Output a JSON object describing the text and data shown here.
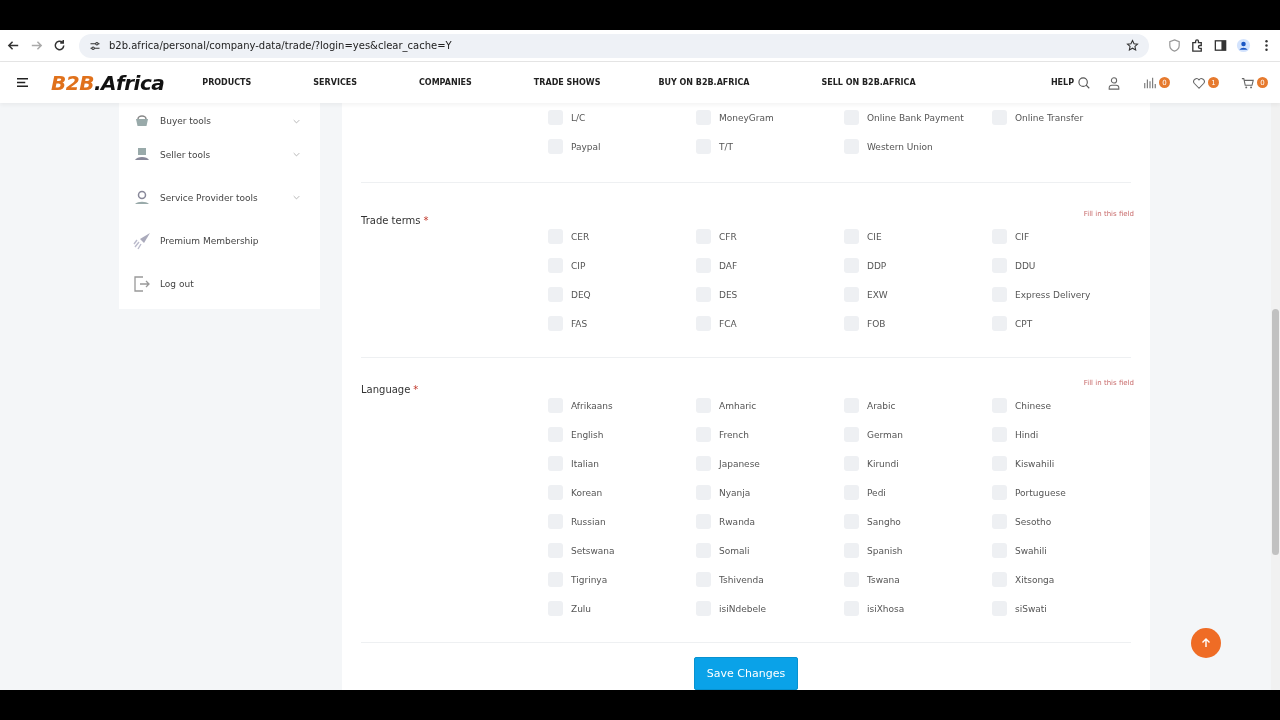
{
  "browser": {
    "url": "b2b.africa/personal/company-data/trade/?login=yes&clear_cache=Y"
  },
  "header": {
    "logo": {
      "brand": "B2B",
      "suffix": ".Africa"
    },
    "nav": [
      "PRODUCTS",
      "SERVICES",
      "COMPANIES",
      "TRADE SHOWS",
      "BUY ON B2B.AFRICA",
      "SELL ON B2B.AFRICA"
    ],
    "help": "HELP",
    "compare_count": "0",
    "wishlist_count": "1",
    "cart_count": "0"
  },
  "sidebar": {
    "items": [
      {
        "label": "Buyer tools",
        "expandable": true
      },
      {
        "label": "Seller tools",
        "expandable": true
      },
      {
        "label": "Service Provider tools",
        "expandable": true
      },
      {
        "label": "Premium Membership",
        "expandable": false
      },
      {
        "label": "Log out",
        "expandable": false
      }
    ]
  },
  "sections": [
    {
      "options": [
        {
          "label": "L/C",
          "checked": false
        },
        {
          "label": "MoneyGram",
          "checked": false
        },
        {
          "label": "Online Bank Payment",
          "checked": false
        },
        {
          "label": "Online Transfer",
          "checked": false
        },
        {
          "label": "Paypal",
          "checked": false
        },
        {
          "label": "T/T",
          "checked": false
        },
        {
          "label": "Western Union",
          "checked": false
        }
      ]
    },
    {
      "label": "Trade terms",
      "required_mark": "*",
      "error": "Fill in this field",
      "options": [
        {
          "label": "CER",
          "checked": false
        },
        {
          "label": "CFR",
          "checked": false
        },
        {
          "label": "CIE",
          "checked": false
        },
        {
          "label": "CIF",
          "checked": false
        },
        {
          "label": "CIP",
          "checked": false
        },
        {
          "label": "DAF",
          "checked": false
        },
        {
          "label": "DDP",
          "checked": false
        },
        {
          "label": "DDU",
          "checked": false
        },
        {
          "label": "DEQ",
          "checked": false
        },
        {
          "label": "DES",
          "checked": false
        },
        {
          "label": "EXW",
          "checked": false
        },
        {
          "label": "Express Delivery",
          "checked": false
        },
        {
          "label": "FAS",
          "checked": false
        },
        {
          "label": "FCA",
          "checked": false
        },
        {
          "label": "FOB",
          "checked": false
        },
        {
          "label": "CPT",
          "checked": false
        }
      ]
    },
    {
      "label": "Language",
      "required_mark": "*",
      "error": "Fill in this field",
      "options": [
        {
          "label": "Afrikaans",
          "checked": false
        },
        {
          "label": "Amharic",
          "checked": false
        },
        {
          "label": "Arabic",
          "checked": false
        },
        {
          "label": "Chinese",
          "checked": false
        },
        {
          "label": "English",
          "checked": false
        },
        {
          "label": "French",
          "checked": false
        },
        {
          "label": "German",
          "checked": false
        },
        {
          "label": "Hindi",
          "checked": false
        },
        {
          "label": "Italian",
          "checked": false
        },
        {
          "label": "Japanese",
          "checked": false
        },
        {
          "label": "Kirundi",
          "checked": false
        },
        {
          "label": "Kiswahili",
          "checked": false
        },
        {
          "label": "Korean",
          "checked": false
        },
        {
          "label": "Nyanja",
          "checked": false
        },
        {
          "label": "Pedi",
          "checked": false
        },
        {
          "label": "Portuguese",
          "checked": false
        },
        {
          "label": "Russian",
          "checked": false
        },
        {
          "label": "Rwanda",
          "checked": false
        },
        {
          "label": "Sangho",
          "checked": false
        },
        {
          "label": "Sesotho",
          "checked": false
        },
        {
          "label": "Setswana",
          "checked": false
        },
        {
          "label": "Somali",
          "checked": false
        },
        {
          "label": "Spanish",
          "checked": false
        },
        {
          "label": "Swahili",
          "checked": false
        },
        {
          "label": "Tigrinya",
          "checked": false
        },
        {
          "label": "Tshivenda",
          "checked": false
        },
        {
          "label": "Tswana",
          "checked": false
        },
        {
          "label": "Xitsonga",
          "checked": false
        },
        {
          "label": "Zulu",
          "checked": false
        },
        {
          "label": "isiNdebele",
          "checked": false
        },
        {
          "label": "isiXhosa",
          "checked": false
        },
        {
          "label": "siSwati",
          "checked": false
        }
      ]
    }
  ],
  "save_button": "Save Changes"
}
